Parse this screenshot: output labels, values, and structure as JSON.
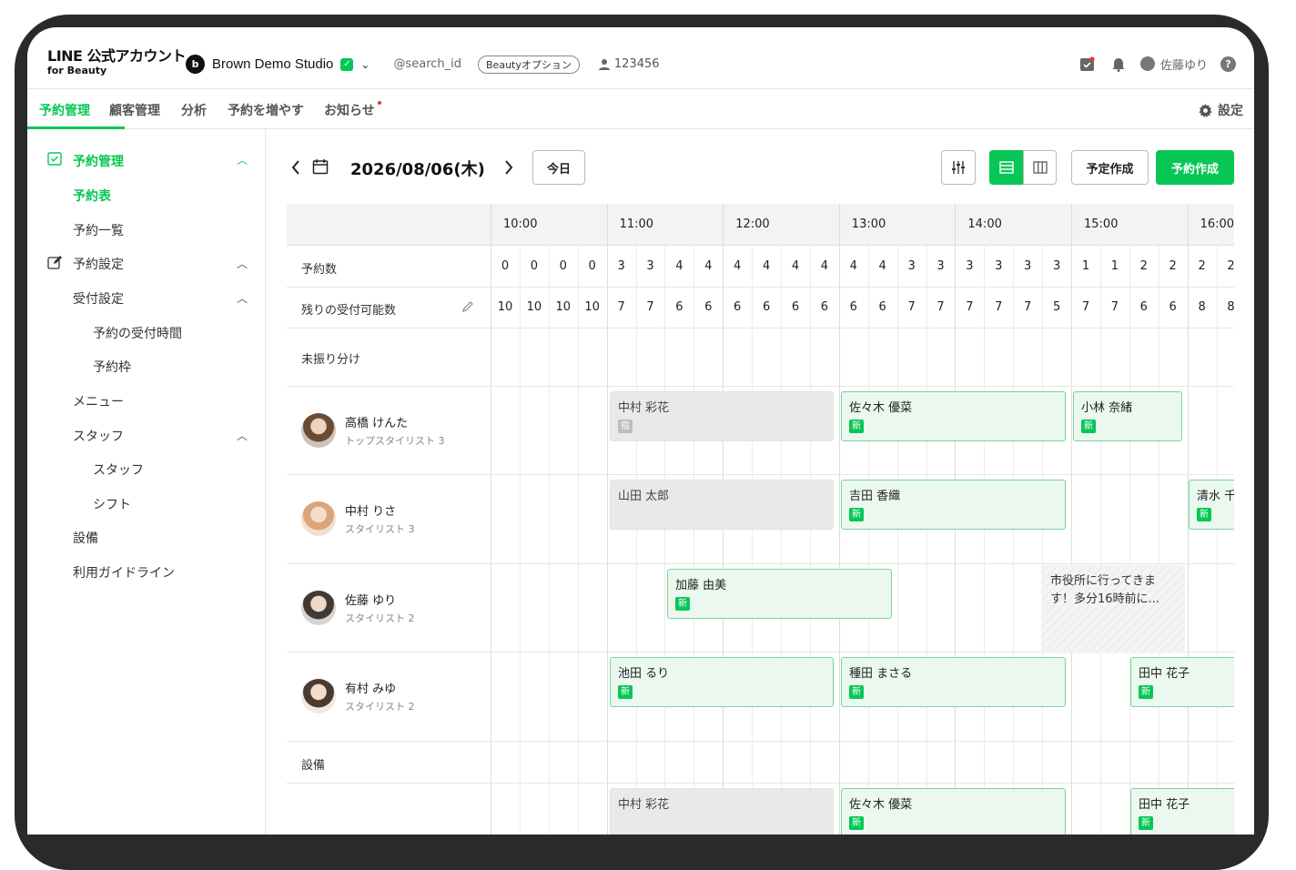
{
  "header": {
    "logo_main": "LINE 公式アカウント",
    "logo_sub": "for Beauty",
    "account_icon": "b",
    "account_name": "Brown Demo Studio",
    "search_id": "@search_id",
    "badge": "Beautyオプション",
    "user_id": "123456",
    "user_name": "佐藤ゆり",
    "help": "?"
  },
  "nav": {
    "items": [
      "予約管理",
      "顧客管理",
      "分析",
      "予約を増やす",
      "お知らせ"
    ],
    "settings": "設定"
  },
  "sidebar": {
    "items": [
      "予約管理",
      "予約表",
      "予約一覧",
      "予約設定",
      "受付設定",
      "予約の受付時間",
      "予約枠",
      "メニュー",
      "スタッフ",
      "スタッフ",
      "シフト",
      "設備",
      "利用ガイドライン"
    ]
  },
  "toolbar": {
    "date": "2026/08/06(木)",
    "today": "今日",
    "plan_create": "予定作成",
    "reserve_create": "予約作成"
  },
  "schedule": {
    "times": [
      "10:00",
      "11:00",
      "12:00",
      "13:00",
      "14:00",
      "15:00",
      "16:00"
    ],
    "count_label": "予約数",
    "remaining_label": "残りの受付可能数",
    "unassigned_label": "未振り分け",
    "equipment_label": "設備",
    "counts": [
      "0",
      "0",
      "0",
      "0",
      "3",
      "3",
      "4",
      "4",
      "4",
      "4",
      "4",
      "4",
      "4",
      "4",
      "3",
      "3",
      "3",
      "3",
      "3",
      "3",
      "1",
      "1",
      "2",
      "2",
      "2",
      "2"
    ],
    "remaining": [
      "10",
      "10",
      "10",
      "10",
      "7",
      "7",
      "6",
      "6",
      "6",
      "6",
      "6",
      "6",
      "6",
      "6",
      "7",
      "7",
      "7",
      "7",
      "7",
      "5",
      "7",
      "7",
      "6",
      "6",
      "8",
      "8"
    ],
    "staff": [
      {
        "name": "高橋 けんた",
        "role": "トップスタイリスト 3"
      },
      {
        "name": "中村 りさ",
        "role": "スタイリスト 3"
      },
      {
        "name": "佐藤 ゆり",
        "role": "スタイリスト 2"
      },
      {
        "name": "有村 みゆ",
        "role": "スタイリスト 2"
      }
    ],
    "appointments": {
      "a1": {
        "name": "中村 彩花",
        "tag": "指"
      },
      "a2": {
        "name": "佐々木 優菜",
        "tag": "新"
      },
      "a3": {
        "name": "小林 奈緒",
        "tag": "新"
      },
      "a4": {
        "name": "山田 太郎"
      },
      "a5": {
        "name": "吉田 香織",
        "tag": "新"
      },
      "a6": {
        "name": "清水 千",
        "tag": "新"
      },
      "a7": {
        "name": "加藤 由美",
        "tag": "新"
      },
      "a8": {
        "name": "池田 るり",
        "tag": "新"
      },
      "a9": {
        "name": "種田 まさる",
        "tag": "新"
      },
      "a10": {
        "name": "田中 花子",
        "tag": "新"
      },
      "a11": {
        "name": "中村 彩花"
      },
      "a12": {
        "name": "佐々木 優菜",
        "tag": "新"
      },
      "a13": {
        "name": "田中 花子",
        "tag": "新"
      }
    },
    "note": "市役所に行ってきます！多分16時前に..."
  },
  "colors": {
    "accent": "#06c755"
  }
}
